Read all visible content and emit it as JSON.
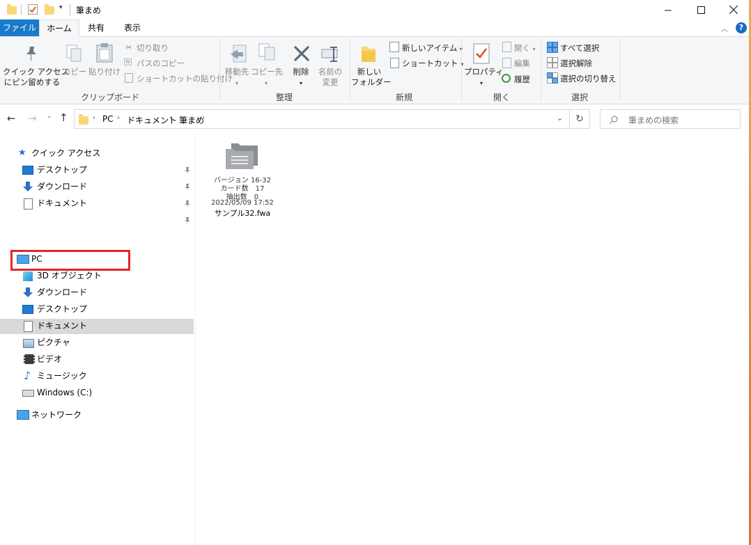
{
  "window": {
    "title": "筆まめ",
    "minimize_icon": "minimize-icon",
    "maximize_icon": "maximize-icon",
    "close_icon": "close-icon"
  },
  "ribbon_tabs": {
    "file": "ファイル",
    "home": "ホーム",
    "share": "共有",
    "view": "表示"
  },
  "ribbon": {
    "clipboard": {
      "pin_line1": "クイック アクセス",
      "pin_line2": "にピン留めする",
      "copy": "コピー",
      "paste": "貼り付け",
      "cut": "切り取り",
      "copy_path": "パスのコピー",
      "paste_shortcut": "ショートカットの貼り付け",
      "label": "クリップボード"
    },
    "organize": {
      "move_to": "移動先",
      "copy_to": "コピー先",
      "delete": "削除",
      "rename_line1": "名前の",
      "rename_line2": "変更",
      "label": "整理"
    },
    "new": {
      "new_folder_line1": "新しい",
      "new_folder_line2": "フォルダー",
      "new_item": "新しいアイテム",
      "easy_access": "ショートカット",
      "label": "新規"
    },
    "open": {
      "properties": "プロパティ",
      "open": "開く",
      "edit": "編集",
      "history": "履歴",
      "label": "開く"
    },
    "select": {
      "select_all": "すべて選択",
      "select_none": "選択解除",
      "invert": "選択の切り替え",
      "label": "選択"
    }
  },
  "address": {
    "crumbs": [
      "PC",
      "ドキュメント",
      "筆まめ"
    ],
    "search_placeholder": "筆まめの検索"
  },
  "nav": {
    "quick_access": "クイック アクセス",
    "qa_items": [
      "デスクトップ",
      "ダウンロード",
      "ドキュメント"
    ],
    "pc": "PC",
    "pc_items": [
      "3D オブジェクト",
      "ダウンロード",
      "デスクトップ",
      "ドキュメント",
      "ピクチャ",
      "ビデオ",
      "ミュージック",
      "Windows (C:)"
    ],
    "network": "ネットワーク",
    "selected_item": "ドキュメント"
  },
  "file": {
    "line1": "バージョン 16-32",
    "line2": "カード数　17",
    "line3": "抽出数　0",
    "line4": "2022/05/09 17:52",
    "name": "サンプル32.fwa"
  },
  "colors": {
    "accent": "#1979ca",
    "highlight_box": "#e3262a",
    "selection": "#d9d9d9"
  }
}
